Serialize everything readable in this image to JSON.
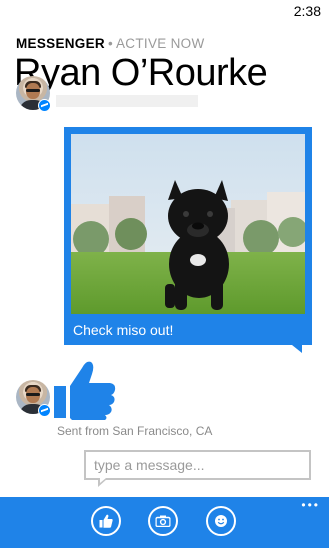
{
  "status_bar": {
    "time": "2:38"
  },
  "header": {
    "app_name": "MESSENGER",
    "separator": "•",
    "presence": "ACTIVE NOW",
    "contact_name": "Ryan O’Rourke"
  },
  "messages": {
    "photo_caption": "Check miso out!",
    "sticker": "thumbs-up-icon",
    "sent_from": "Sent from San Francisco, CA"
  },
  "compose": {
    "placeholder": "type a message..."
  },
  "app_bar": {
    "buttons": [
      "like-icon",
      "camera-icon",
      "emoji-icon"
    ],
    "more": "•••"
  },
  "colors": {
    "accent": "#1f83e8",
    "messenger_badge": "#0084ff"
  }
}
